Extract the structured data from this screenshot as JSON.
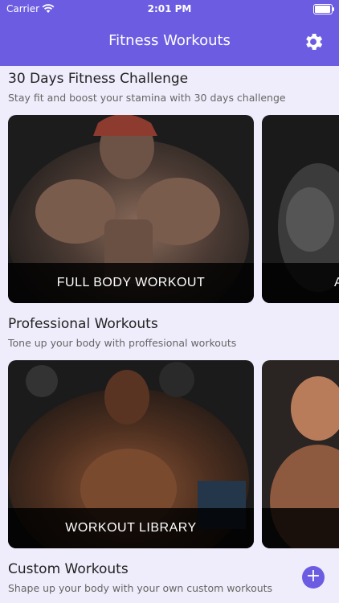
{
  "status_bar": {
    "carrier": "Carrier",
    "time": "2:01 PM"
  },
  "header": {
    "title": "Fitness Workouts",
    "settings_icon": "gear-icon"
  },
  "sections": [
    {
      "title": "30 Days Fitness Challenge",
      "subtitle": "Stay fit and boost your stamina with 30 days challenge",
      "cards": [
        {
          "label": "FULL BODY WORKOUT"
        },
        {
          "label": "A"
        }
      ]
    },
    {
      "title": "Professional Workouts",
      "subtitle": "Tone up your body with proffesional workouts",
      "cards": [
        {
          "label": "WORKOUT LIBRARY"
        }
      ]
    },
    {
      "title": "Custom Workouts",
      "subtitle": "Shape up your body with your own custom workouts",
      "add_icon": "plus-icon"
    }
  ],
  "colors": {
    "accent": "#6c5ce2",
    "background": "#efedfb"
  }
}
